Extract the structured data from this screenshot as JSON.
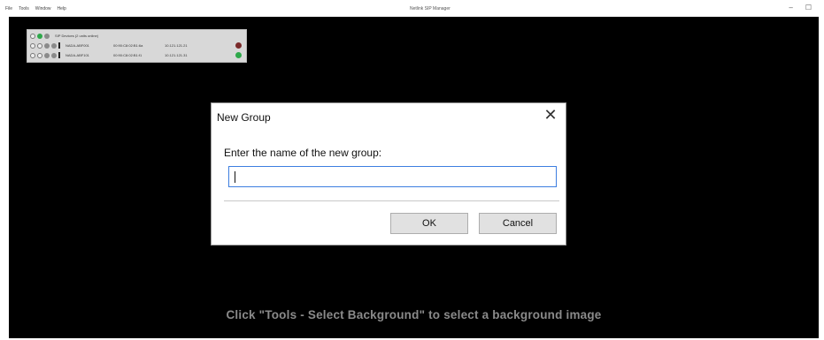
{
  "menu": [
    "File",
    "Tools",
    "Window",
    "Help"
  ],
  "app_title": "Netlink SIP Manager",
  "window_controls": [
    "–",
    "☐"
  ],
  "device_panel": {
    "header": "SIP Devices (2 units online)",
    "rows": [
      {
        "name": "NADA-ABF001",
        "mac": "00:90:C8:02:B1:6a",
        "ip": "10.121.121.21",
        "status_color": "#7a2a2a"
      },
      {
        "name": "NADA-ABF101",
        "mac": "00:90:C8:02:B1:f1",
        "ip": "10.121.121.31",
        "status_color": "#2ea84a"
      }
    ]
  },
  "background_hint": "Click \"Tools - Select Background\" to select a background image",
  "dialog": {
    "title": "New Group",
    "prompt": "Enter the name of the new group:",
    "input_value": "",
    "ok_label": "OK",
    "cancel_label": "Cancel",
    "close_glyph": "✕"
  }
}
